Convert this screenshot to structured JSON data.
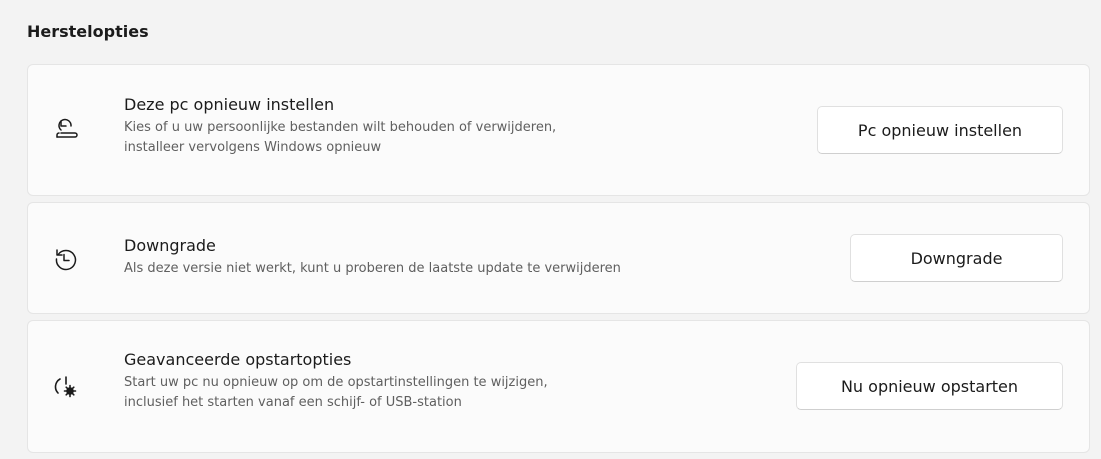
{
  "section": {
    "title": "Herstelopties"
  },
  "cards": [
    {
      "icon": "reset-pc-icon",
      "title": "Deze pc opnieuw instellen",
      "description": "Kies of u uw persoonlijke bestanden wilt behouden of verwijderen,\ninstalleer vervolgens Windows opnieuw",
      "button_label": "Pc opnieuw instellen"
    },
    {
      "icon": "history-icon",
      "title": "Downgrade",
      "description": "Als deze versie niet werkt, kunt u proberen de laatste update te verwijderen",
      "button_label": "Downgrade"
    },
    {
      "icon": "advanced-startup-icon",
      "title": "Geavanceerde opstartopties",
      "description": "Start uw pc nu opnieuw op om de opstartinstellingen te wijzigen,\ninclusief het starten vanaf een schijf- of USB-station",
      "button_label": "Nu opnieuw opstarten"
    }
  ]
}
